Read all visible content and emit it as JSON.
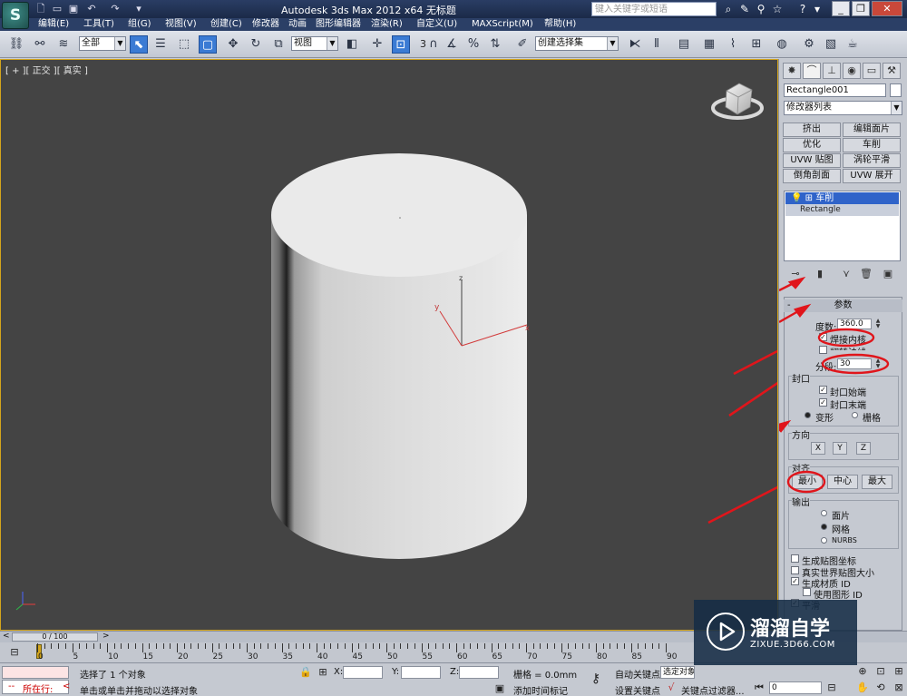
{
  "titlebar": {
    "title": "Autodesk 3ds Max  2012 x64    无标题",
    "search_placeholder": "键入关键字或短语",
    "logo_text": "S"
  },
  "menu": [
    "编辑(E)",
    "工具(T)",
    "组(G)",
    "视图(V)",
    "创建(C)",
    "修改器",
    "动画",
    "图形编辑器",
    "渲染(R)",
    "自定义(U)",
    "MAXScript(M)",
    "帮助(H)"
  ],
  "toolbar": {
    "selection_filter": "全部",
    "reference_coord": "视图",
    "named_selection": "创建选择集",
    "snap_label": "3"
  },
  "viewport": {
    "label": "[ + ][ 正交 ][ 真实 ]",
    "gizmo_x": "x",
    "gizmo_y": "y",
    "gizmo_z": "z"
  },
  "panel": {
    "object_name": "Rectangle001",
    "modifier_list": "修改器列表",
    "modifier_buttons": [
      "挤出",
      "编辑面片",
      "优化",
      "车削",
      "UVW 贴图",
      "涡轮平滑",
      "倒角剖面",
      "UVW 展开"
    ],
    "stack_top": "车削",
    "stack_bottom": "Rectangle",
    "rollout_title": "参数",
    "degrees_label": "度数:",
    "degrees_value": "360.0",
    "weld_core_label": "焊接内核",
    "flip_normals_label": "翻转法线",
    "segments_label": "分段:",
    "segments_value": "30",
    "capping_label": "封口",
    "cap_start_label": "封口始端",
    "cap_end_label": "封口末端",
    "morph_label": "变形",
    "grid_label": "栅格",
    "direction_label": "方向",
    "axis_x": "X",
    "axis_y": "Y",
    "axis_z": "Z",
    "align_label": "对齐",
    "align_min": "最小",
    "align_center": "中心",
    "align_max": "最大",
    "output_label": "输出",
    "out_patch": "面片",
    "out_mesh": "网格",
    "out_nurbs": "NURBS",
    "gen_mapping": "生成贴图坐标",
    "real_world": "真实世界贴图大小",
    "gen_mat_id": "生成材质 ID",
    "use_shape_id": "使用图形 ID",
    "smooth": "平滑"
  },
  "timeline": {
    "slider": "0 / 100",
    "ticks": [
      "0",
      "5",
      "10",
      "15",
      "20",
      "25",
      "30",
      "35",
      "40",
      "45",
      "50",
      "55",
      "60",
      "65",
      "70",
      "75",
      "80",
      "85",
      "90"
    ]
  },
  "status": {
    "current": "所在行:",
    "selected": "选择了 1 个对象",
    "prompt": "单击或单击并拖动以选择对象",
    "x_label": "X:",
    "y_label": "Y:",
    "z_label": "Z:",
    "grid": "栅格 = 0.0mm",
    "add_time_tag": "添加时间标记",
    "auto_key": "自动关键点",
    "selected_obj": "选定对象",
    "set_key": "设置关键点",
    "key_filters": "关键点过滤器...",
    "frame": "0"
  },
  "watermark": {
    "title": "溜溜自学",
    "url": "ZIXUE.3D66.COM"
  },
  "colors": {
    "annotation": "#e0151b",
    "viewport_bg": "#444444",
    "selection_blue": "#2f63c9"
  }
}
